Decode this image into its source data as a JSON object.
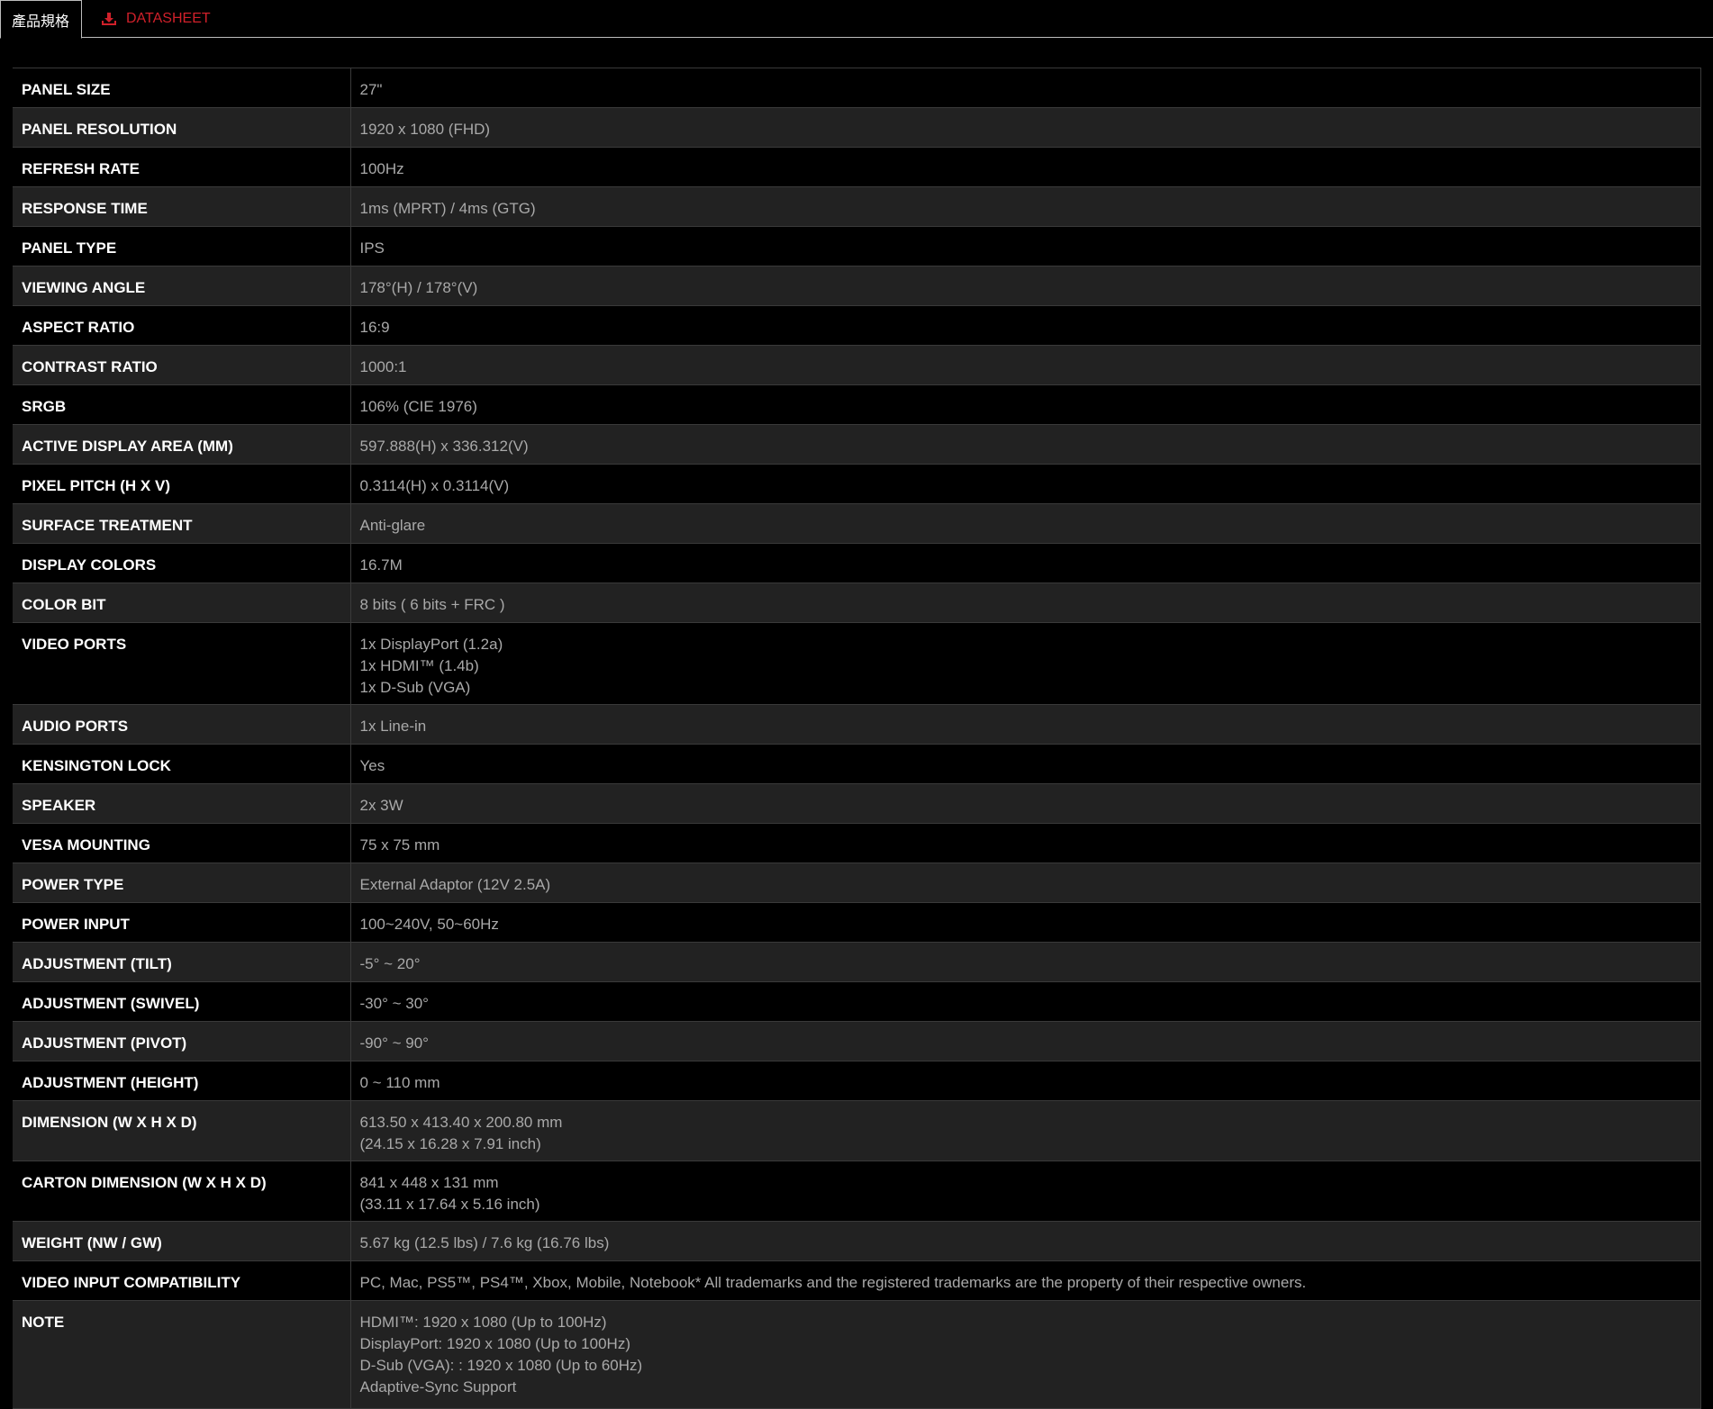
{
  "tabs": {
    "specs_label": "產品規格",
    "datasheet_label": "DATASHEET",
    "datasheet_icon": "download-icon",
    "accent_color": "#d0202a"
  },
  "specs": [
    {
      "label": "PANEL SIZE",
      "lines": [
        "27\""
      ]
    },
    {
      "label": "PANEL RESOLUTION",
      "lines": [
        "1920 x 1080 (FHD)"
      ]
    },
    {
      "label": "REFRESH RATE",
      "lines": [
        "100Hz"
      ]
    },
    {
      "label": "RESPONSE TIME",
      "lines": [
        "1ms (MPRT) / 4ms (GTG)"
      ]
    },
    {
      "label": "PANEL TYPE",
      "lines": [
        "IPS"
      ]
    },
    {
      "label": "VIEWING ANGLE",
      "lines": [
        "178°(H) / 178°(V)"
      ]
    },
    {
      "label": "ASPECT RATIO",
      "lines": [
        "16:9"
      ]
    },
    {
      "label": "CONTRAST RATIO",
      "lines": [
        "1000:1"
      ]
    },
    {
      "label": "SRGB",
      "lines": [
        "106% (CIE 1976)"
      ]
    },
    {
      "label": "ACTIVE DISPLAY AREA (MM)",
      "lines": [
        "597.888(H) x 336.312(V)"
      ]
    },
    {
      "label": "PIXEL PITCH (H X V)",
      "lines": [
        "0.3114(H) x 0.3114(V)"
      ]
    },
    {
      "label": "SURFACE TREATMENT",
      "lines": [
        "Anti-glare"
      ]
    },
    {
      "label": "DISPLAY COLORS",
      "lines": [
        "16.7M"
      ]
    },
    {
      "label": "COLOR BIT",
      "lines": [
        "8 bits ( 6 bits + FRC )"
      ]
    },
    {
      "label": "VIDEO PORTS",
      "lines": [
        "1x DisplayPort (1.2a)",
        "1x HDMI™ (1.4b)",
        "1x D-Sub (VGA)"
      ]
    },
    {
      "label": "AUDIO PORTS",
      "lines": [
        "1x Line-in"
      ]
    },
    {
      "label": "KENSINGTON LOCK",
      "lines": [
        "Yes"
      ]
    },
    {
      "label": "SPEAKER",
      "lines": [
        "2x 3W"
      ]
    },
    {
      "label": "VESA MOUNTING",
      "lines": [
        "75 x 75 mm"
      ]
    },
    {
      "label": "POWER TYPE",
      "lines": [
        "External Adaptor (12V 2.5A)"
      ]
    },
    {
      "label": "POWER INPUT",
      "lines": [
        "100~240V, 50~60Hz"
      ]
    },
    {
      "label": "ADJUSTMENT (TILT)",
      "lines": [
        "-5° ~ 20°"
      ]
    },
    {
      "label": "ADJUSTMENT (SWIVEL)",
      "lines": [
        "-30° ~ 30°"
      ]
    },
    {
      "label": "ADJUSTMENT (PIVOT)",
      "lines": [
        "-90° ~ 90°"
      ]
    },
    {
      "label": "ADJUSTMENT (HEIGHT)",
      "lines": [
        "0 ~ 110 mm"
      ]
    },
    {
      "label": "DIMENSION (W X H X D)",
      "lines": [
        "613.50 x 413.40 x 200.80 mm",
        "(24.15 x 16.28 x 7.91 inch)"
      ]
    },
    {
      "label": "CARTON DIMENSION (W X H X D)",
      "lines": [
        "841 x 448 x 131 mm",
        "(33.11 x 17.64 x 5.16 inch)"
      ]
    },
    {
      "label": "WEIGHT (NW / GW)",
      "lines": [
        "5.67 kg (12.5 lbs) / 7.6 kg (16.76 lbs)"
      ]
    },
    {
      "label": "VIDEO INPUT COMPATIBILITY",
      "lines": [
        "PC, Mac, PS5™, PS4™, Xbox, Mobile, Notebook* All trademarks and the registered trademarks are the property of their respective owners."
      ]
    },
    {
      "label": "NOTE",
      "lines": [
        "HDMI™: 1920 x 1080 (Up to 100Hz)",
        "DisplayPort: 1920 x 1080 (Up to 100Hz)",
        "D-Sub (VGA): : 1920 x 1080 (Up to 60Hz)",
        "Adaptive-Sync Support"
      ]
    }
  ]
}
